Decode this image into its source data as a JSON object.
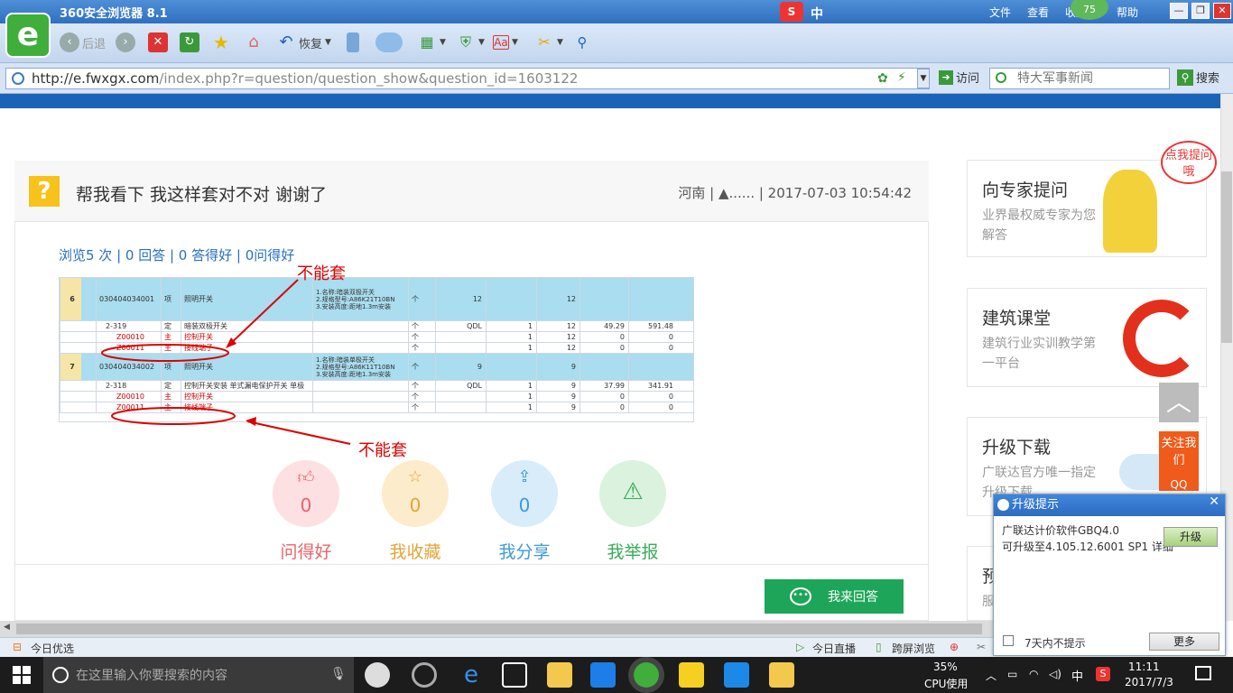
{
  "browser": {
    "title": "360安全浏览器 8.1",
    "logo": "e",
    "menu": [
      "文件",
      "查看",
      "收藏",
      "帮助"
    ],
    "badge": "75",
    "toolbar": {
      "back": "后退",
      "restore": "恢复"
    },
    "url_domain": "http://e.fwxgx.com",
    "url_path": "/index.php?r=question/question_show&question_id=1603122",
    "visit": "访问",
    "search_placeholder": "特大军事新闻",
    "search_btn": "搜索",
    "ime": "中"
  },
  "question": {
    "icon": "?",
    "title": "帮我看下 我这样套对不对 谢谢了",
    "meta": "河南 | ▲...... | 2017-07-03 10:54:42",
    "stats": "浏览5 次 | 0 回答 | 0 答得好 | 0问得好",
    "annotation": "不能套"
  },
  "table": {
    "rows": [
      {
        "no": "6",
        "code": "030404034001",
        "type": "项",
        "name": "照明开关",
        "desc": "1.名称:暗装双极开关\n2.规格型号:A86K21T10BN\n3.安装高度:距地1.3m安装",
        "unit": "个",
        "q1": "12",
        "q2": "",
        "q3": "",
        "q4": "12",
        "p": "",
        "t": ""
      },
      {
        "no": "",
        "code": "2-319",
        "type": "定",
        "name": "暗装双极开关",
        "desc": "",
        "unit": "个",
        "q1": "QDL",
        "q2": "1",
        "q3": "",
        "q4": "12",
        "p": "49.29",
        "t": "591.48"
      },
      {
        "no": "",
        "code": "Z00010",
        "type": "主",
        "name": "控制开关",
        "desc": "",
        "unit": "个",
        "q1": "",
        "q2": "1",
        "q3": "",
        "q4": "12",
        "p": "0",
        "t": "0"
      },
      {
        "no": "",
        "code": "Z00011",
        "type": "主",
        "name": "接线端子",
        "desc": "",
        "unit": "个",
        "q1": "",
        "q2": "1",
        "q3": "",
        "q4": "12",
        "p": "0",
        "t": "0"
      },
      {
        "no": "7",
        "code": "030404034002",
        "type": "项",
        "name": "照明开关",
        "desc": "1.名称:暗装单极开关\n2.规格型号:A86K11T10BN\n3.安装高度:距地1.3m安装",
        "unit": "个",
        "q1": "9",
        "q2": "",
        "q3": "",
        "q4": "9",
        "p": "",
        "t": ""
      },
      {
        "no": "",
        "code": "2-318",
        "type": "定",
        "name": "控制开关安装 单式漏电保护开关 单极",
        "desc": "",
        "unit": "个",
        "q1": "QDL",
        "q2": "1",
        "q3": "",
        "q4": "9",
        "p": "37.99",
        "t": "341.91"
      },
      {
        "no": "",
        "code": "Z00010",
        "type": "主",
        "name": "控制开关",
        "desc": "",
        "unit": "个",
        "q1": "",
        "q2": "1",
        "q3": "",
        "q4": "9",
        "p": "0",
        "t": "0"
      },
      {
        "no": "",
        "code": "Z00011",
        "type": "主",
        "name": "接线端子",
        "desc": "",
        "unit": "个",
        "q1": "",
        "q2": "1",
        "q3": "",
        "q4": "9",
        "p": "0",
        "t": "0"
      }
    ]
  },
  "actions": [
    {
      "label": "问得好",
      "count": "0",
      "icon": "thumb-up-icon",
      "color": "#e8636b",
      "bg": "#fde0e2"
    },
    {
      "label": "我收藏",
      "count": "0",
      "icon": "star-icon",
      "color": "#e2a53a",
      "bg": "#fdeccb"
    },
    {
      "label": "我分享",
      "count": "0",
      "icon": "share-icon",
      "color": "#3c9ad8",
      "bg": "#d8ecfa"
    },
    {
      "label": "我举报",
      "count": "",
      "icon": "warning-icon",
      "color": "#3bab5b",
      "bg": "#daf2de"
    }
  ],
  "answer_button": "我来回答",
  "sidebar": [
    {
      "title": "向专家提问",
      "sub": "业界最权威专家为您解答",
      "bubble": "点我提问哦"
    },
    {
      "title": "建筑课堂",
      "sub": "建筑行业实训教学第一平台"
    },
    {
      "title": "升级下载",
      "sub": "广联达官方唯一指定升级下载"
    },
    {
      "title": "预",
      "sub": "服"
    }
  ],
  "float": {
    "follow": "关注我们",
    "qq": "QQ"
  },
  "popup": {
    "title": "升级提示",
    "line1": "广联达计价软件GBQ4.0",
    "line2": "可升级至4.105.12.6001 SP1 详细",
    "upgrade": "升级",
    "checkbox": "7天内不提示",
    "more": "更多"
  },
  "statusbar": {
    "left": "今日优选",
    "live": "今日直播",
    "cross": "跨屏浏览"
  },
  "taskbar": {
    "search": "在这里输入你要搜索的内容",
    "cpu": "35%",
    "cpu_label": "CPU使用",
    "ime": "中",
    "time": "11:11",
    "date": "2017/7/3"
  }
}
